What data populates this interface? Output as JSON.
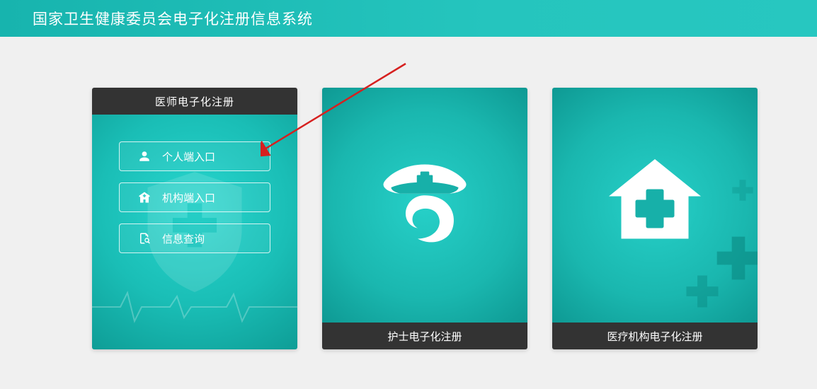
{
  "banner": {
    "title": "国家卫生健康委员会电子化注册信息系统"
  },
  "cards": [
    {
      "header": "医师电子化注册",
      "buttons": [
        {
          "icon": "user-icon",
          "label": "个人端入口"
        },
        {
          "icon": "hospital-icon",
          "label": "机构端入口"
        },
        {
          "icon": "search-doc-icon",
          "label": "信息查询"
        }
      ]
    },
    {
      "footer": "护士电子化注册"
    },
    {
      "footer": "医疗机构电子化注册"
    }
  ],
  "colors": {
    "teal": "#1dc0b9",
    "darkbar": "#333333"
  }
}
